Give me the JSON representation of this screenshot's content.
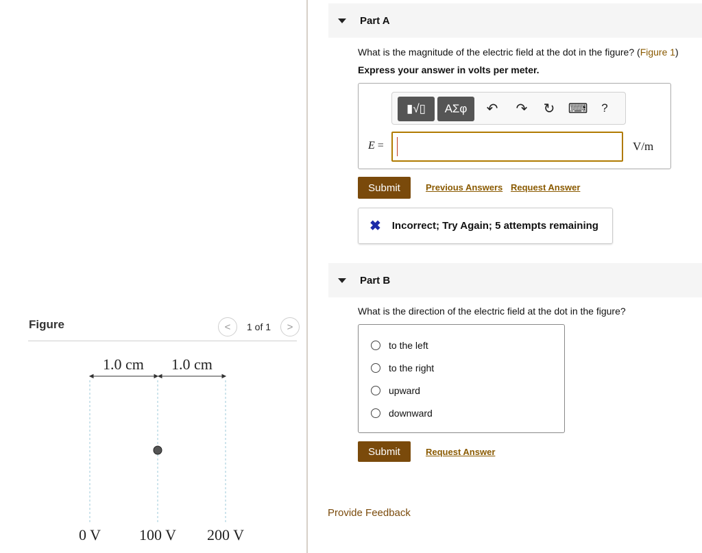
{
  "figure": {
    "title": "Figure",
    "pager_label": "1 of 1",
    "prev_glyph": "<",
    "next_glyph": ">",
    "dimension_labels": [
      "1.0 cm",
      "1.0 cm"
    ],
    "voltage_labels": [
      "0 V",
      "100 V",
      "200 V"
    ]
  },
  "part_a": {
    "label": "Part A",
    "question": "What is the magnitude of the electric field at the dot in the figure? (",
    "figure_link": "Figure 1",
    "question_end": ")",
    "instruction": "Express your answer in volts per meter.",
    "toolbar": {
      "templates_glyph": "▮√▯",
      "symbols_glyph": "ΑΣφ",
      "undo_glyph": "↶",
      "redo_glyph": "↷",
      "reset_glyph": "↻",
      "keyboard_glyph": "⌨",
      "help_glyph": "?"
    },
    "variable": "E",
    "equals": "=",
    "input_value": "",
    "unit": "V/m",
    "submit_label": "Submit",
    "previous_answers_label": "Previous Answers",
    "request_answer_label": "Request Answer",
    "feedback_icon": "✖",
    "feedback_text": "Incorrect; Try Again; 5 attempts remaining"
  },
  "part_b": {
    "label": "Part B",
    "question": "What is the direction of the electric field at the dot in the figure?",
    "options": [
      "to the left",
      "to the right",
      "upward",
      "downward"
    ],
    "submit_label": "Submit",
    "request_answer_label": "Request Answer"
  },
  "provide_feedback_label": "Provide Feedback",
  "colors": {
    "accent_brown": "#7a4a0b",
    "link_brown": "#8a5a00",
    "incorrect_blue": "#1b2aa8"
  }
}
